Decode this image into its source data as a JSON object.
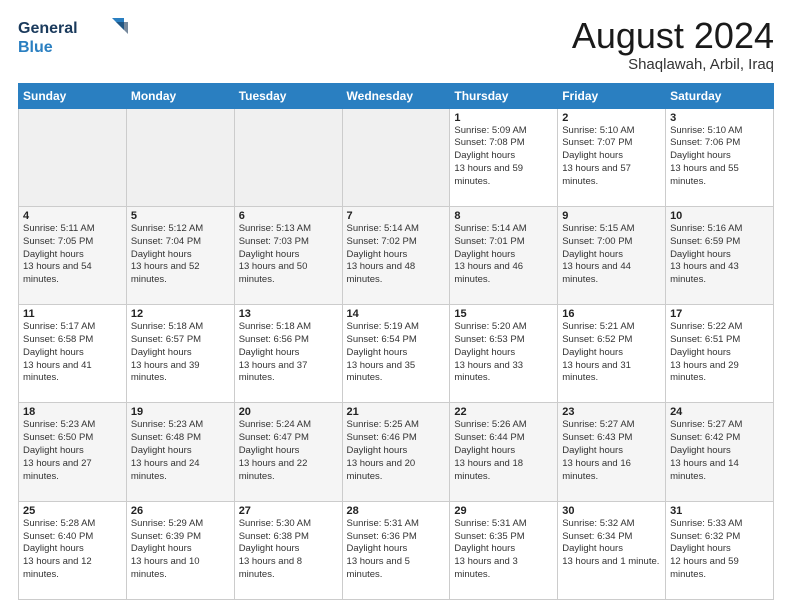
{
  "logo": {
    "line1": "General",
    "line2": "Blue"
  },
  "title": "August 2024",
  "location": "Shaqlawah, Arbil, Iraq",
  "weekdays": [
    "Sunday",
    "Monday",
    "Tuesday",
    "Wednesday",
    "Thursday",
    "Friday",
    "Saturday"
  ],
  "weeks": [
    [
      {
        "day": "",
        "empty": true
      },
      {
        "day": "",
        "empty": true
      },
      {
        "day": "",
        "empty": true
      },
      {
        "day": "",
        "empty": true
      },
      {
        "day": "1",
        "sunrise": "5:09 AM",
        "sunset": "7:08 PM",
        "daylight": "13 hours and 59 minutes."
      },
      {
        "day": "2",
        "sunrise": "5:10 AM",
        "sunset": "7:07 PM",
        "daylight": "13 hours and 57 minutes."
      },
      {
        "day": "3",
        "sunrise": "5:10 AM",
        "sunset": "7:06 PM",
        "daylight": "13 hours and 55 minutes."
      }
    ],
    [
      {
        "day": "4",
        "sunrise": "5:11 AM",
        "sunset": "7:05 PM",
        "daylight": "13 hours and 54 minutes."
      },
      {
        "day": "5",
        "sunrise": "5:12 AM",
        "sunset": "7:04 PM",
        "daylight": "13 hours and 52 minutes."
      },
      {
        "day": "6",
        "sunrise": "5:13 AM",
        "sunset": "7:03 PM",
        "daylight": "13 hours and 50 minutes."
      },
      {
        "day": "7",
        "sunrise": "5:14 AM",
        "sunset": "7:02 PM",
        "daylight": "13 hours and 48 minutes."
      },
      {
        "day": "8",
        "sunrise": "5:14 AM",
        "sunset": "7:01 PM",
        "daylight": "13 hours and 46 minutes."
      },
      {
        "day": "9",
        "sunrise": "5:15 AM",
        "sunset": "7:00 PM",
        "daylight": "13 hours and 44 minutes."
      },
      {
        "day": "10",
        "sunrise": "5:16 AM",
        "sunset": "6:59 PM",
        "daylight": "13 hours and 43 minutes."
      }
    ],
    [
      {
        "day": "11",
        "sunrise": "5:17 AM",
        "sunset": "6:58 PM",
        "daylight": "13 hours and 41 minutes."
      },
      {
        "day": "12",
        "sunrise": "5:18 AM",
        "sunset": "6:57 PM",
        "daylight": "13 hours and 39 minutes."
      },
      {
        "day": "13",
        "sunrise": "5:18 AM",
        "sunset": "6:56 PM",
        "daylight": "13 hours and 37 minutes."
      },
      {
        "day": "14",
        "sunrise": "5:19 AM",
        "sunset": "6:54 PM",
        "daylight": "13 hours and 35 minutes."
      },
      {
        "day": "15",
        "sunrise": "5:20 AM",
        "sunset": "6:53 PM",
        "daylight": "13 hours and 33 minutes."
      },
      {
        "day": "16",
        "sunrise": "5:21 AM",
        "sunset": "6:52 PM",
        "daylight": "13 hours and 31 minutes."
      },
      {
        "day": "17",
        "sunrise": "5:22 AM",
        "sunset": "6:51 PM",
        "daylight": "13 hours and 29 minutes."
      }
    ],
    [
      {
        "day": "18",
        "sunrise": "5:23 AM",
        "sunset": "6:50 PM",
        "daylight": "13 hours and 27 minutes."
      },
      {
        "day": "19",
        "sunrise": "5:23 AM",
        "sunset": "6:48 PM",
        "daylight": "13 hours and 24 minutes."
      },
      {
        "day": "20",
        "sunrise": "5:24 AM",
        "sunset": "6:47 PM",
        "daylight": "13 hours and 22 minutes."
      },
      {
        "day": "21",
        "sunrise": "5:25 AM",
        "sunset": "6:46 PM",
        "daylight": "13 hours and 20 minutes."
      },
      {
        "day": "22",
        "sunrise": "5:26 AM",
        "sunset": "6:44 PM",
        "daylight": "13 hours and 18 minutes."
      },
      {
        "day": "23",
        "sunrise": "5:27 AM",
        "sunset": "6:43 PM",
        "daylight": "13 hours and 16 minutes."
      },
      {
        "day": "24",
        "sunrise": "5:27 AM",
        "sunset": "6:42 PM",
        "daylight": "13 hours and 14 minutes."
      }
    ],
    [
      {
        "day": "25",
        "sunrise": "5:28 AM",
        "sunset": "6:40 PM",
        "daylight": "13 hours and 12 minutes."
      },
      {
        "day": "26",
        "sunrise": "5:29 AM",
        "sunset": "6:39 PM",
        "daylight": "13 hours and 10 minutes."
      },
      {
        "day": "27",
        "sunrise": "5:30 AM",
        "sunset": "6:38 PM",
        "daylight": "13 hours and 8 minutes."
      },
      {
        "day": "28",
        "sunrise": "5:31 AM",
        "sunset": "6:36 PM",
        "daylight": "13 hours and 5 minutes."
      },
      {
        "day": "29",
        "sunrise": "5:31 AM",
        "sunset": "6:35 PM",
        "daylight": "13 hours and 3 minutes."
      },
      {
        "day": "30",
        "sunrise": "5:32 AM",
        "sunset": "6:34 PM",
        "daylight": "13 hours and 1 minute."
      },
      {
        "day": "31",
        "sunrise": "5:33 AM",
        "sunset": "6:32 PM",
        "daylight": "12 hours and 59 minutes."
      }
    ]
  ],
  "labels": {
    "sunrise": "Sunrise:",
    "sunset": "Sunset:",
    "daylight": "Daylight hours"
  }
}
